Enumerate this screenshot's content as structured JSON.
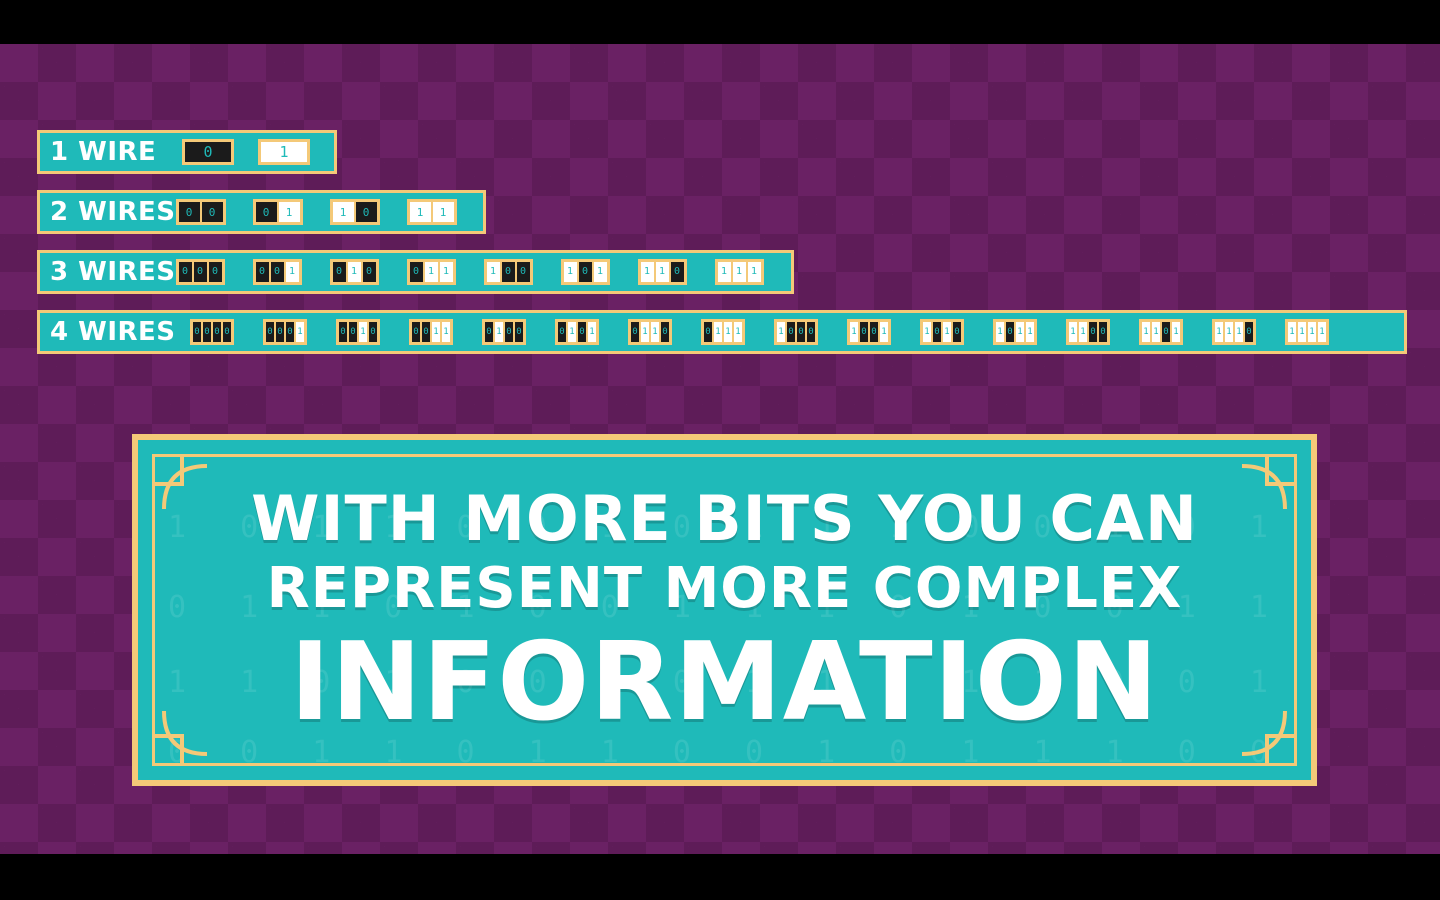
{
  "wires": [
    {
      "label": "1 WIRE",
      "combos": [
        "0",
        "1"
      ]
    },
    {
      "label": "2 WIRES",
      "combos": [
        "00",
        "01",
        "10",
        "11"
      ]
    },
    {
      "label": "3 WIRES",
      "combos": [
        "000",
        "001",
        "010",
        "011",
        "100",
        "101",
        "110",
        "111"
      ]
    },
    {
      "label": "4 WIRES",
      "combos": [
        "0000",
        "0001",
        "0010",
        "0011",
        "0100",
        "0101",
        "0110",
        "0111",
        "1000",
        "1001",
        "1010",
        "1011",
        "1100",
        "1101",
        "1110",
        "1111"
      ]
    }
  ],
  "banner": {
    "line1": "WITH MORE BITS YOU CAN",
    "line2": "REPRESENT MORE COMPLEX",
    "line3": "INFORMATION"
  },
  "colors": {
    "background": "#6a2164",
    "checker": "#5e1c58",
    "teal": "#1fbab9",
    "gold": "#f4c978",
    "bit_off": "#1b1b1b",
    "bit_on": "#ffffff"
  }
}
